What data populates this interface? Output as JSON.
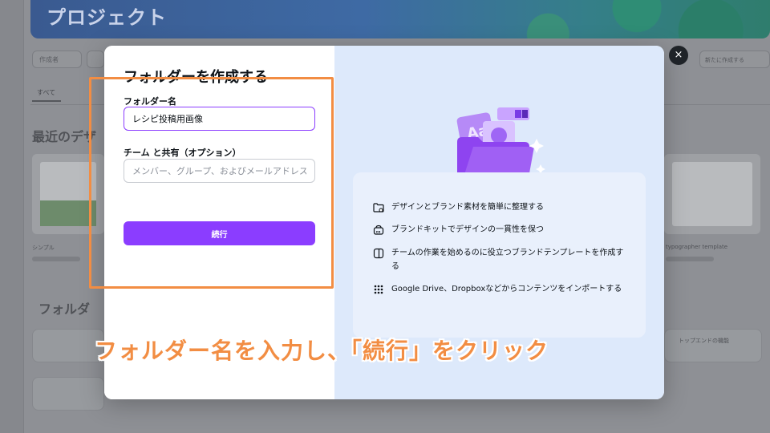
{
  "background": {
    "page_title": "プロジェクト",
    "filter_pill": "作成者",
    "tab_all": "すべて",
    "recent_heading": "最近のデザ",
    "folders_heading": "フォルダ",
    "thumb_caption": "シンプル",
    "thumb_caption_right": "typographer template",
    "row_caption_right": "トップエンドの機能",
    "topright_button": "新たに作成する"
  },
  "modal": {
    "title": "フォルダーを作成する",
    "folder_name_label": "フォルダー名",
    "folder_name_value": "レシピ投稿用画像",
    "share_label": "チーム と共有（オプション）",
    "share_placeholder": "メンバー、グループ、およびメールアドレス...",
    "continue_label": "続行",
    "close_label": "×",
    "features": [
      {
        "icon": "folder-settings-icon",
        "text": "デザインとブランド素材を簡単に整理する"
      },
      {
        "icon": "brand-kit-icon",
        "text": "ブランドキットでデザインの一貫性を保つ"
      },
      {
        "icon": "template-icon",
        "text": "チームの作業を始めるのに役立つブランドテンプレートを作成する"
      },
      {
        "icon": "apps-grid-icon",
        "text": "Google Drive、Dropboxなどからコンテンツをインポートする"
      }
    ]
  },
  "colors": {
    "accent": "#8b3dff",
    "annotation": "#f28d43",
    "panel_right": "#dde9fb"
  },
  "annotation": {
    "caption": "フォルダー名を入力し、「続行」をクリック"
  }
}
